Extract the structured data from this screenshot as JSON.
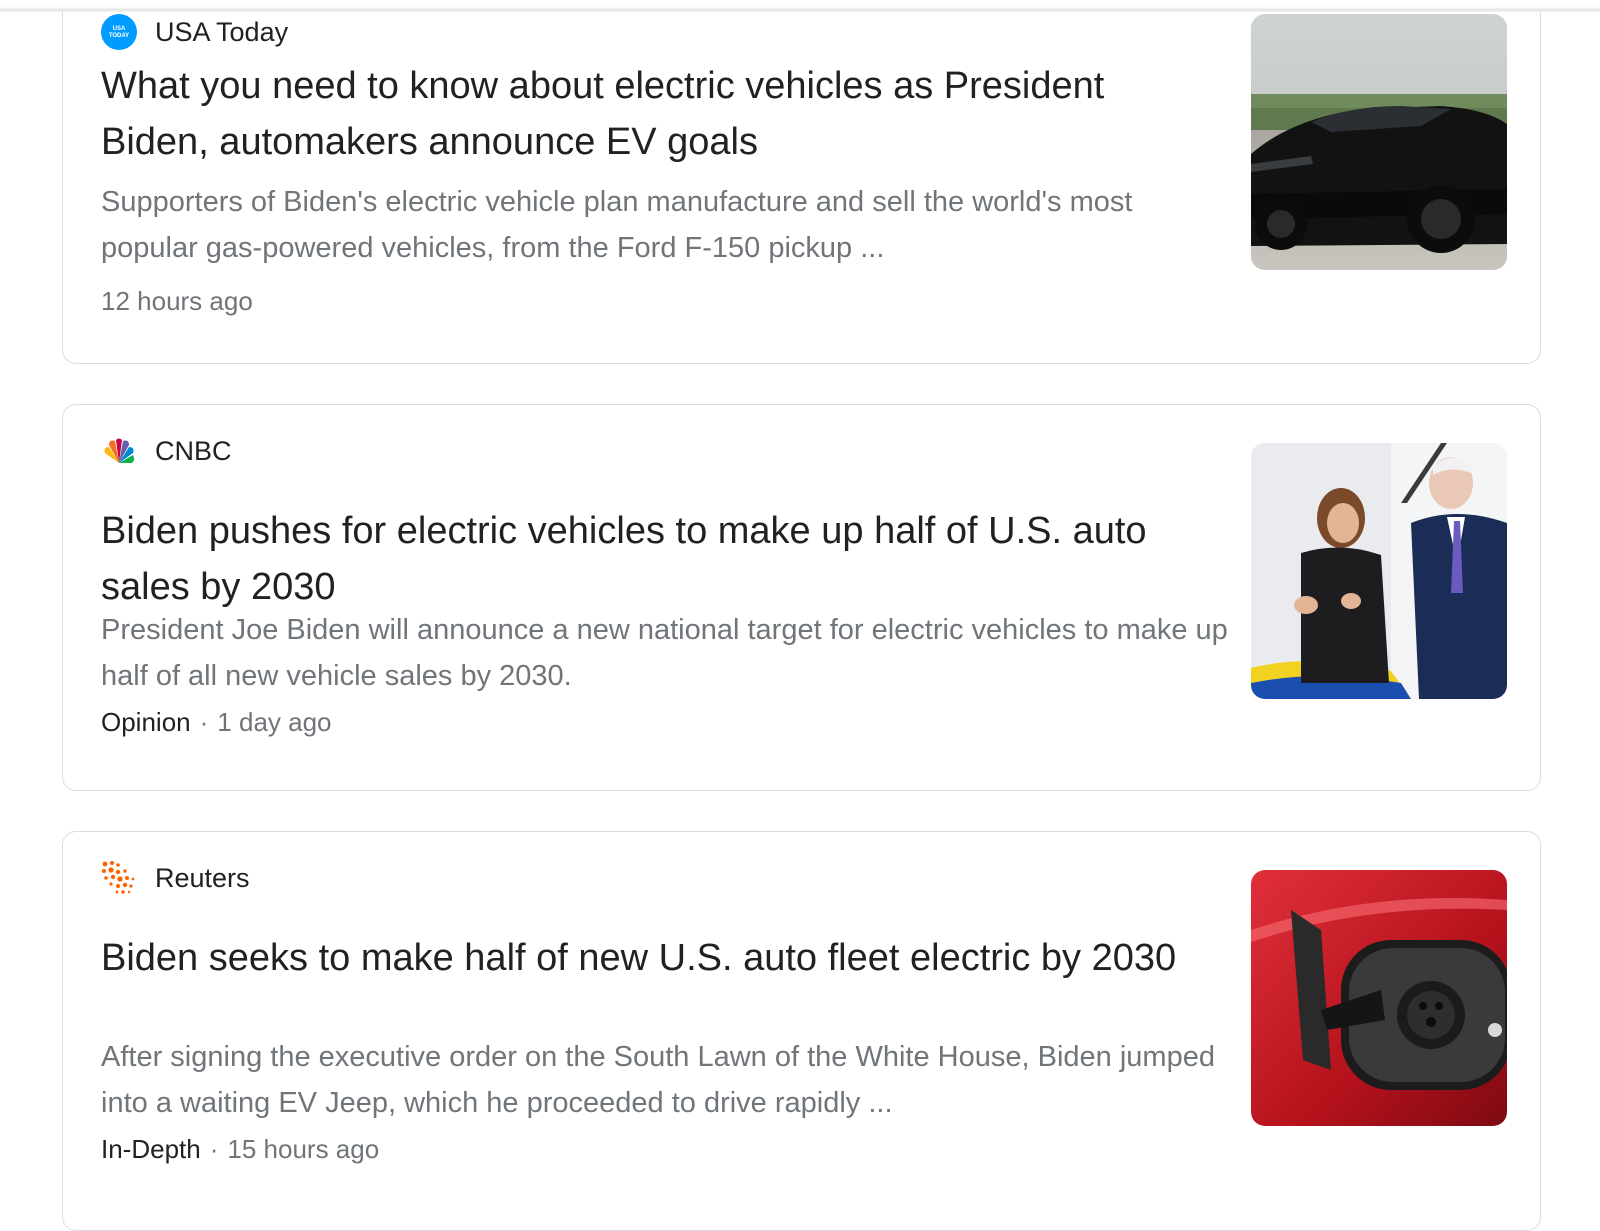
{
  "articles": [
    {
      "source": "USA Today",
      "source_logo_icon": "usa-today-logo-icon",
      "headline": "What you need to know about electric vehicles as President Biden, automakers announce EV goals",
      "snippet": "Supporters of Biden's electric vehicle plan manufacture and sell the world's most popular gas-powered vehicles, from the Ford F-150 pickup ...",
      "label": "",
      "time": "12 hours ago",
      "thumbnail_icon": "black-suv-image"
    },
    {
      "source": "CNBC",
      "source_logo_icon": "cnbc-peacock-logo-icon",
      "headline": "Biden pushes for electric vehicles to make up half of U.S. auto sales by 2030",
      "snippet": "President Joe Biden will announce a new national target for electric vehicles to make up half of all new vehicle sales by 2030.",
      "label": "Opinion",
      "time": "1 day ago",
      "thumbnail_icon": "people-with-car-image"
    },
    {
      "source": "Reuters",
      "source_logo_icon": "reuters-dots-logo-icon",
      "headline": "Biden seeks to make half of new U.S. auto fleet electric by 2030",
      "snippet": "After signing the executive order on the South Lawn of the White House, Biden jumped into a waiting EV Jeep, which he proceeded to drive rapidly ...",
      "label": "In-Depth",
      "time": "15 hours ago",
      "thumbnail_icon": "ev-charging-port-image"
    }
  ],
  "separator": "·",
  "colors": {
    "usa_today_blue": "#009bff",
    "reuters_orange": "#fa6400",
    "text_primary": "#202124",
    "text_secondary": "#70757a",
    "border": "#dadce0"
  }
}
